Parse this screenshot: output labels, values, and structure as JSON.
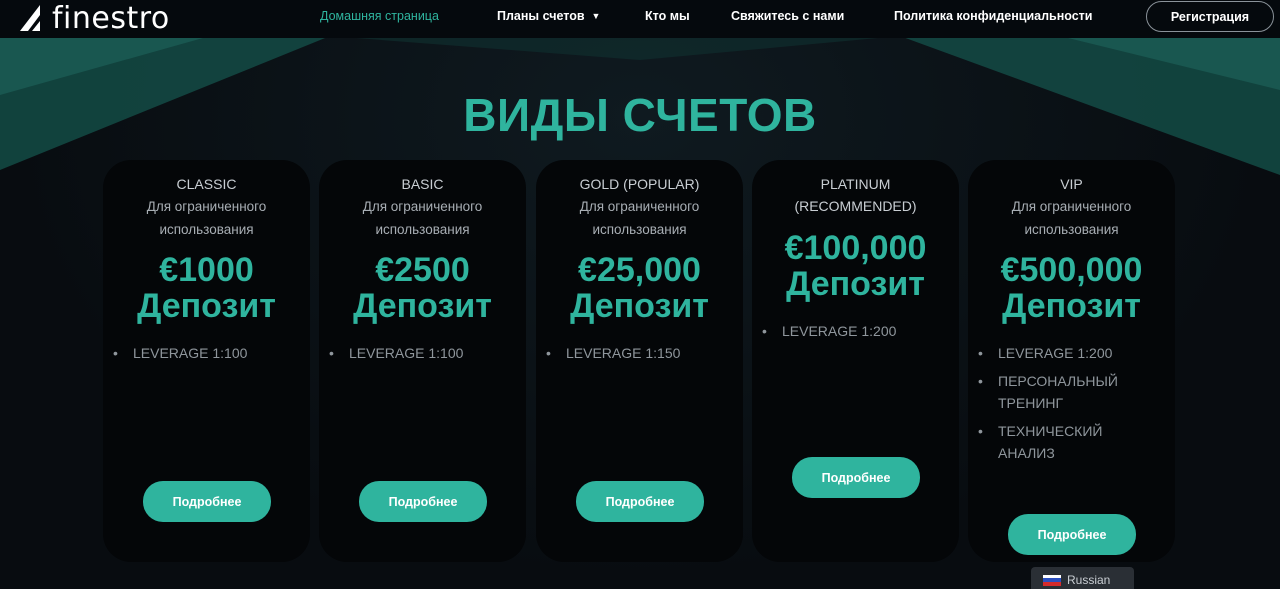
{
  "brand": {
    "name": "finestro"
  },
  "nav": {
    "home": "Домашняя страница",
    "plans": "Планы счетов",
    "about": "Кто мы",
    "contact": "Свяжитесь с нами",
    "privacy": "Политика конфиденциальности",
    "register": "Регистрация"
  },
  "page": {
    "title": "ВИДЫ СЧЕТОВ"
  },
  "cards": [
    {
      "name": "CLASSIC",
      "sub_line1": "Для ограниченного",
      "sub_line2": "использования",
      "price": "€1000",
      "price_label": "Депозит",
      "features": [
        "LEVERAGE 1:100"
      ],
      "button": "Подробнее"
    },
    {
      "name": "BASIC",
      "sub_line1": "Для ограниченного",
      "sub_line2": "использования",
      "price": "€2500",
      "price_label": "Депозит",
      "features": [
        "LEVERAGE 1:100"
      ],
      "button": "Подробнее"
    },
    {
      "name": "GOLD (POPULAR)",
      "sub_line1": "Для ограниченного",
      "sub_line2": "использования",
      "price": "€25,000",
      "price_label": "Депозит",
      "features": [
        "LEVERAGE 1:150"
      ],
      "button": "Подробнее"
    },
    {
      "name_line1": "PLATINUM",
      "name_line2": "(RECOMMENDED)",
      "price": "€100,000",
      "price_label": "Депозит",
      "features": [
        "LEVERAGE 1:200"
      ],
      "button": "Подробнее"
    },
    {
      "name": "VIP",
      "sub_line1": "Для ограниченного",
      "sub_line2": "использования",
      "price": "€500,000",
      "price_label": "Депозит",
      "features": [
        "LEVERAGE 1:200",
        "ПЕРСОНАЛЬНЫЙ ТРЕНИНГ",
        "ТЕХНИЧЕСКИЙ АНАЛИЗ"
      ],
      "button": "Подробнее"
    }
  ],
  "language": {
    "label": "Russian"
  },
  "colors": {
    "accent": "#2fb49e",
    "background": "#0a0f14",
    "card": "#040608"
  },
  "icons": {
    "logo": "finestro-logo-mark",
    "plans_dropdown": "chevron-down-icon",
    "flag": "russia-flag-icon"
  }
}
